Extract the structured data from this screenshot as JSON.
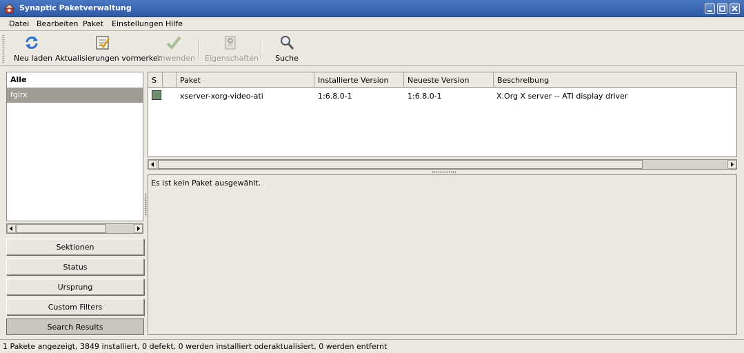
{
  "window": {
    "title": "Synaptic Paketverwaltung"
  },
  "menu": {
    "items": [
      "Datei",
      "Bearbeiten",
      "Paket",
      "Einstellungen",
      "Hilfe"
    ]
  },
  "toolbar": {
    "reload_label": "Neu laden",
    "mark_upgrades_label": "Aktualisierungen vormerken",
    "apply_label": "Anwenden",
    "properties_label": "Eigenschaften",
    "search_label": "Suche"
  },
  "filters": {
    "items": [
      {
        "label": "Alle"
      },
      {
        "label": "fglrx"
      }
    ]
  },
  "sections": {
    "buttons": [
      "Sektionen",
      "Status",
      "Ursprung",
      "Custom Filters",
      "Search Results"
    ]
  },
  "table": {
    "headers": {
      "status": "S",
      "package": "Paket",
      "installed": "Installierte Version",
      "latest": "Neueste Version",
      "description": "Beschreibung"
    },
    "rows": [
      {
        "package": "xserver-xorg-video-ati",
        "installed": "1:6.8.0-1",
        "latest": "1:6.8.0-1",
        "description": "X.Org X server -- ATI display driver",
        "status_color": "#6d8f6b"
      }
    ]
  },
  "details": {
    "text": "Es ist kein Paket ausgewählt."
  },
  "statusbar": {
    "text": "1 Pakete angezeigt, 3849 installiert, 0 defekt, 0 werden installiert oderaktualisiert, 0 werden entfernt"
  },
  "colors": {
    "titlebar": "#3a66b1",
    "selection": "#9f9c95",
    "window_bg": "#ece9e2"
  }
}
